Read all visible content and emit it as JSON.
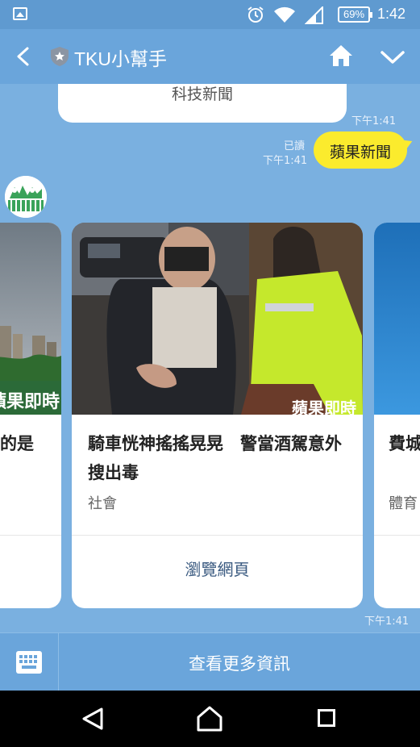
{
  "status_bar": {
    "battery": "69%",
    "time": "1:42",
    "icons": [
      "image-icon",
      "alarm-icon",
      "wifi-icon",
      "signal-icon",
      "battery-icon"
    ]
  },
  "header": {
    "title": "TKU小幫手",
    "icons": [
      "back-arrow-icon",
      "shield-star-icon",
      "home-icon",
      "chevron-down-icon"
    ]
  },
  "chat": {
    "prev_bot_bubble": "科技新聞",
    "prev_timestamp": "下午1:41",
    "user_message": "蘋果新聞",
    "read_label": "已讀",
    "user_timestamp": "下午1:41",
    "carousel": {
      "cards": [
        {
          "headline": "的是",
          "watermark": "蘋果即時"
        },
        {
          "headline": "騎車恍神搖搖晃晃　警當酒駕意外搜出毒",
          "category": "社會",
          "action": "瀏覽網頁",
          "watermark": "蘋果即時"
        },
        {
          "headline": "費城分屬",
          "category": "體育"
        }
      ]
    },
    "carousel_timestamp": "下午1:41"
  },
  "bottom_bar": {
    "more_info": "查看更多資訊",
    "keyboard_icon": "keyboard-icon"
  },
  "nav_bar": {
    "icons": [
      "nav-back-icon",
      "nav-home-icon",
      "nav-recent-icon"
    ]
  },
  "colors": {
    "chat_background": "#7ab0e0",
    "header": "#6aa5db",
    "user_bubble": "#fbeb2d",
    "link_text": "#3a5a80"
  }
}
